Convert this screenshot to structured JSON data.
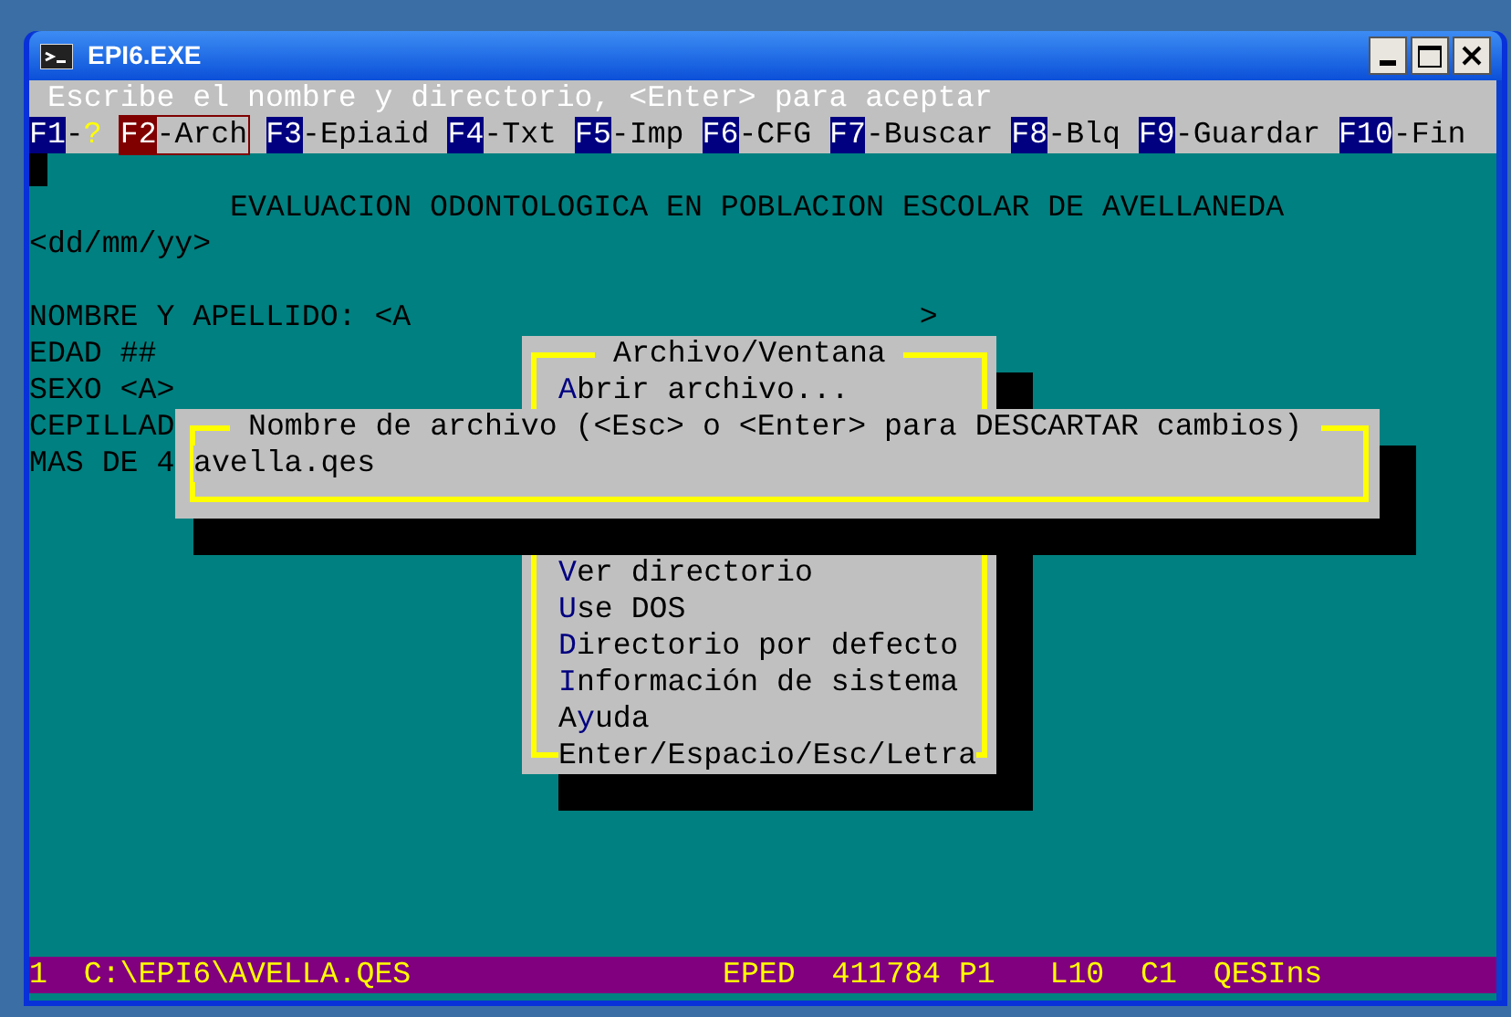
{
  "window": {
    "title": "EPI6.EXE"
  },
  "prompt": "Escribe el nombre y directorio, <Enter> para aceptar",
  "function_keys": [
    {
      "key": "F1",
      "sep": "-",
      "label": "?",
      "kind": "help",
      "selected": false
    },
    {
      "key": "F2",
      "sep": "-",
      "label": "Arch",
      "kind": "command",
      "selected": true
    },
    {
      "key": "F3",
      "sep": "-",
      "label": "Epiaid",
      "kind": "command",
      "selected": false
    },
    {
      "key": "F4",
      "sep": "-",
      "label": "Txt",
      "kind": "command",
      "selected": false
    },
    {
      "key": "F5",
      "sep": "-",
      "label": "Imp",
      "kind": "command",
      "selected": false
    },
    {
      "key": "F6",
      "sep": "-",
      "label": "CFG",
      "kind": "command",
      "selected": false
    },
    {
      "key": "F7",
      "sep": "-",
      "label": "Buscar",
      "kind": "command",
      "selected": false
    },
    {
      "key": "F8",
      "sep": "-",
      "label": "Blq",
      "kind": "command",
      "selected": false
    },
    {
      "key": "F9",
      "sep": "-",
      "label": "Guardar",
      "kind": "command",
      "selected": false
    },
    {
      "key": "F10",
      "sep": "-",
      "label": "Fin",
      "kind": "command",
      "selected": false
    }
  ],
  "form": {
    "title": "EVALUACION ODONTOLOGICA EN POBLACION ESCOLAR DE AVELLANEDA",
    "date_field": "<dd/mm/yy>",
    "fields": [
      "NOMBRE Y APELLIDO: <A                            >",
      "EDAD ##",
      "SEXO <A>",
      "CEPILLAD",
      "MAS DE 4"
    ]
  },
  "menu": {
    "title": "Archivo/Ventana",
    "items": [
      {
        "hotkey": "A",
        "rest": "brir archivo..."
      },
      {
        "hotkey": "V",
        "rest": "er directorio"
      },
      {
        "hotkey": "U",
        "rest": "se DOS"
      },
      {
        "hotkey": "D",
        "rest": "irectorio por defecto"
      },
      {
        "hotkey": "I",
        "rest": "nformación de sistema"
      },
      {
        "prefix": "A",
        "hotkey": "y",
        "rest": "uda"
      }
    ],
    "hint": "Enter/Espacio/Esc/Letra"
  },
  "file_dialog": {
    "title": "Nombre de archivo (<Esc> o <Enter> para DESCARTAR cambios)",
    "value": "avella.qes"
  },
  "status_bar": {
    "left": "1  C:\\EPI6\\AVELLA.QES",
    "right": "EPED  411784 P1   L10  C1  QESIns"
  }
}
